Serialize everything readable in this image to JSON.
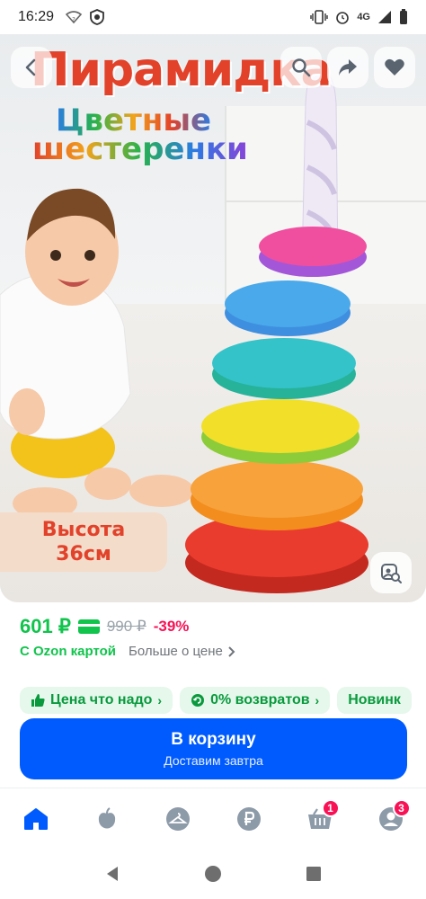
{
  "status_bar": {
    "time": "16:29",
    "network": "4G",
    "icons": [
      "wifi-question-icon",
      "shield-app-icon",
      "vibrate-icon",
      "alarm-icon",
      "signal-icon",
      "battery-icon"
    ]
  },
  "hero": {
    "title": "Пирамидка",
    "subtitle_line1": "Цветные",
    "subtitle_line2": "шестеренки",
    "height_label_line1": "Высота",
    "height_label_line2": "36см",
    "buttons": [
      "back-arrow-icon",
      "search-icon",
      "share-icon",
      "heart-icon",
      "visual-search-icon"
    ]
  },
  "price": {
    "current": "601 ₽",
    "old": "990 ₽",
    "discount": "-39%",
    "ozon_card_label": "С Ozon картой",
    "more_about_price": "Больше о цене"
  },
  "chips": [
    {
      "icon": "thumbs-up-icon",
      "label": "Цена что надо"
    },
    {
      "icon": "return-icon",
      "label": "0% возвратов"
    },
    {
      "icon": "",
      "label": "Новинк"
    }
  ],
  "cart_button": {
    "label": "В корзину",
    "sublabel": "Доставим завтра"
  },
  "bottom_nav": {
    "items": [
      {
        "icon": "home-icon",
        "active": true
      },
      {
        "icon": "fresh-icon",
        "active": false
      },
      {
        "icon": "clothes-hanger-icon",
        "active": false
      },
      {
        "icon": "ruble-icon",
        "active": false
      },
      {
        "icon": "cart-icon",
        "active": false,
        "badge": "1"
      },
      {
        "icon": "profile-icon",
        "active": false,
        "badge": "3"
      }
    ]
  },
  "colors": {
    "accent_blue": "#005bff",
    "price_green": "#10c44c",
    "discount_pink": "#f91155",
    "title_red": "#e2412a"
  }
}
